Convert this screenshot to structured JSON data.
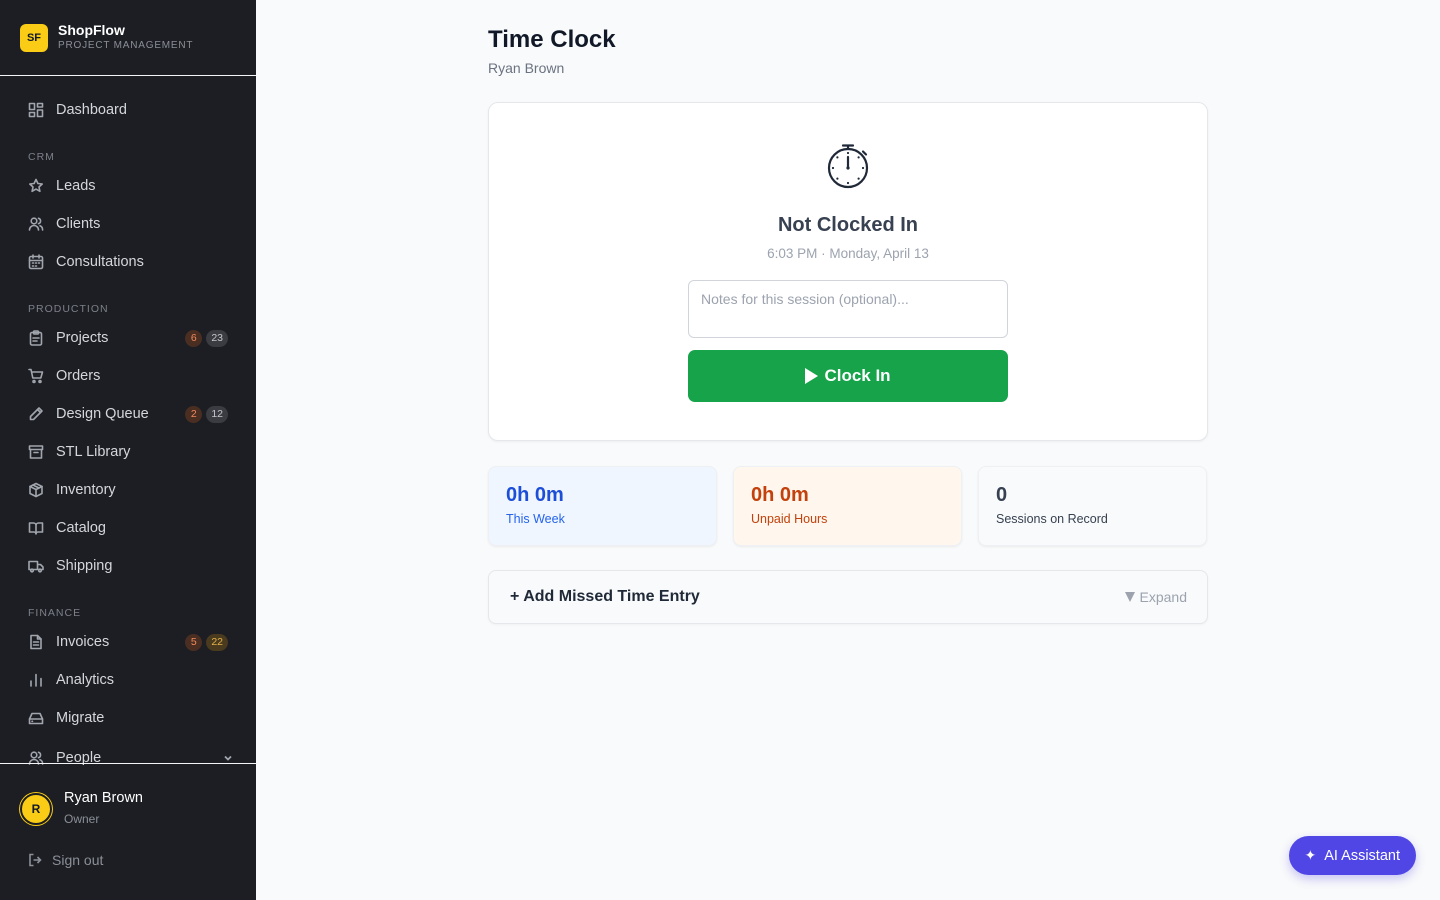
{
  "brand": {
    "logo": "SF",
    "name": "ShopFlow",
    "subtitle": "PROJECT MANAGEMENT"
  },
  "sidebar": {
    "dashboard": {
      "label": "Dashboard",
      "icon": "grid-icon"
    },
    "sections": {
      "crm": "CRM",
      "production": "PRODUCTION",
      "finance": "FINANCE"
    },
    "crm_items": [
      {
        "label": "Leads",
        "icon": "star-icon"
      },
      {
        "label": "Clients",
        "icon": "users-icon"
      },
      {
        "label": "Consultations",
        "icon": "calendar-icon"
      }
    ],
    "production_items": [
      {
        "label": "Projects",
        "icon": "clipboard-icon",
        "badge1": "6",
        "badge2": "23"
      },
      {
        "label": "Orders",
        "icon": "cart-icon"
      },
      {
        "label": "Design Queue",
        "icon": "pencil-icon",
        "badge1": "2",
        "badge2": "12"
      },
      {
        "label": "STL Library",
        "icon": "archive-icon"
      },
      {
        "label": "Inventory",
        "icon": "box-icon"
      },
      {
        "label": "Catalog",
        "icon": "book-icon"
      },
      {
        "label": "Shipping",
        "icon": "truck-icon"
      }
    ],
    "finance_items": [
      {
        "label": "Invoices",
        "icon": "file-icon",
        "badge1": "5",
        "badge2": "22"
      },
      {
        "label": "Analytics",
        "icon": "bar-chart-icon"
      },
      {
        "label": "Migrate",
        "icon": "drive-icon"
      },
      {
        "label": "People",
        "icon": "users-icon"
      }
    ]
  },
  "user": {
    "initial": "R",
    "name": "Ryan Brown",
    "role": "Owner",
    "signout": "Sign out"
  },
  "page": {
    "title": "Time Clock",
    "subtitle": "Ryan Brown"
  },
  "clock": {
    "status": "Not Clocked In",
    "datetime": "6:03 PM · Monday, April 13",
    "notes_placeholder": "Notes for this session (optional)...",
    "button_label": "Clock In"
  },
  "stats": [
    {
      "value": "0h 0m",
      "label": "This Week",
      "color": "#1d4ed8"
    },
    {
      "value": "0h 0m",
      "label": "Unpaid Hours",
      "color": "#c2410c"
    },
    {
      "value": "0",
      "label": "Sessions on Record",
      "color": "#374151"
    }
  ],
  "missed": {
    "title": "+ Add Missed Time Entry",
    "expand": "Expand"
  },
  "ai": {
    "label": "AI Assistant"
  },
  "colors": {
    "accent": "#facc15",
    "clockin": "#16a34a",
    "ai": "#4f46e5",
    "sidebar": "#1c1e23"
  }
}
